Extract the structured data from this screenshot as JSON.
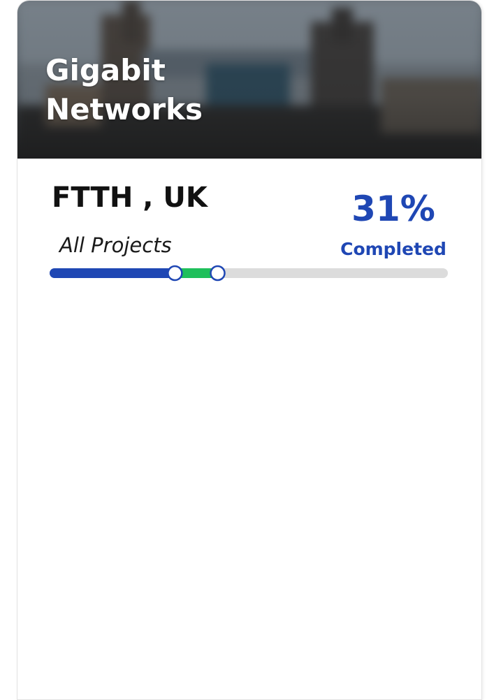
{
  "card": {
    "title": "Gigabit Networks",
    "project_title": "FTTH , UK",
    "project_scope": "All Projects"
  },
  "progress": {
    "percent_text": "31%",
    "percent_label": "Completed",
    "completed_fraction": 0.31,
    "in_progress_fraction": 0.11,
    "colors": {
      "completed": "#1f47b4",
      "in_progress": "#1fbf5b",
      "remaining": "#dcdcdc",
      "marker_stroke": "#1f47b4",
      "marker_fill": "#ffffff"
    }
  },
  "theme": {
    "accent": "#1f47b4",
    "hero_overlay_text": "#ffffff"
  }
}
